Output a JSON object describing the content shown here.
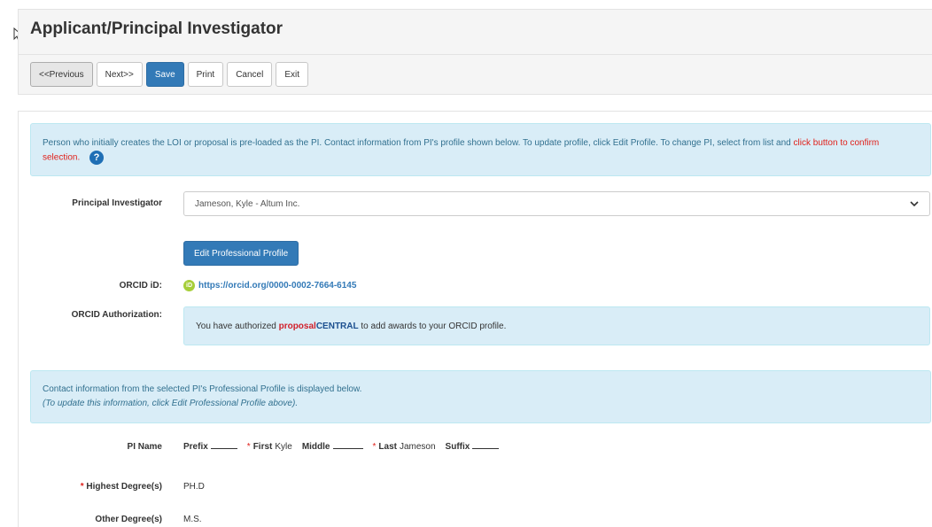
{
  "page": {
    "title": "Applicant/Principal Investigator"
  },
  "toolbar": {
    "previous_label": "<<Previous",
    "next_label": "Next>>",
    "save_label": "Save",
    "print_label": "Print",
    "cancel_label": "Cancel",
    "exit_label": "Exit"
  },
  "intro": {
    "text": "Person who initially creates the LOI or proposal is pre-loaded as the PI. Contact information from PI's profile shown below. To update profile, click Edit Profile. To change PI, select from list and ",
    "highlight": "click button to confirm selection.",
    "help_icon": "?"
  },
  "pi": {
    "label": "Principal Investigator",
    "selected": "Jameson, Kyle - Altum Inc.",
    "edit_button": "Edit Professional Profile"
  },
  "orcid": {
    "id_label": "ORCID iD:",
    "icon_text": "iD",
    "url": "https://orcid.org/0000-0002-7664-6145",
    "auth_label": "ORCID Authorization:",
    "auth_prefix": "You have authorized ",
    "brand_part1": "proposal",
    "brand_part2": "CENTRAL",
    "auth_suffix": " to add awards to your ORCID profile."
  },
  "contact_info": {
    "line1": "Contact information from the selected PI's Professional Profile is displayed below.",
    "line2": "(To update this information, click Edit Professional Profile above)."
  },
  "pi_name": {
    "label": "PI Name",
    "prefix_label": "Prefix",
    "first_label": "First",
    "first_value": "Kyle",
    "middle_label": "Middle",
    "last_label": "Last",
    "last_value": "Jameson",
    "suffix_label": "Suffix"
  },
  "degrees": {
    "highest_label": "Highest Degree(s)",
    "highest_value": "PH.D",
    "other_label": "Other Degree(s)",
    "other_value": "M.S."
  },
  "colors": {
    "primary": "#337ab7",
    "info_bg": "#d9edf7",
    "required": "#e0201a",
    "orcid": "#a6ce39"
  }
}
